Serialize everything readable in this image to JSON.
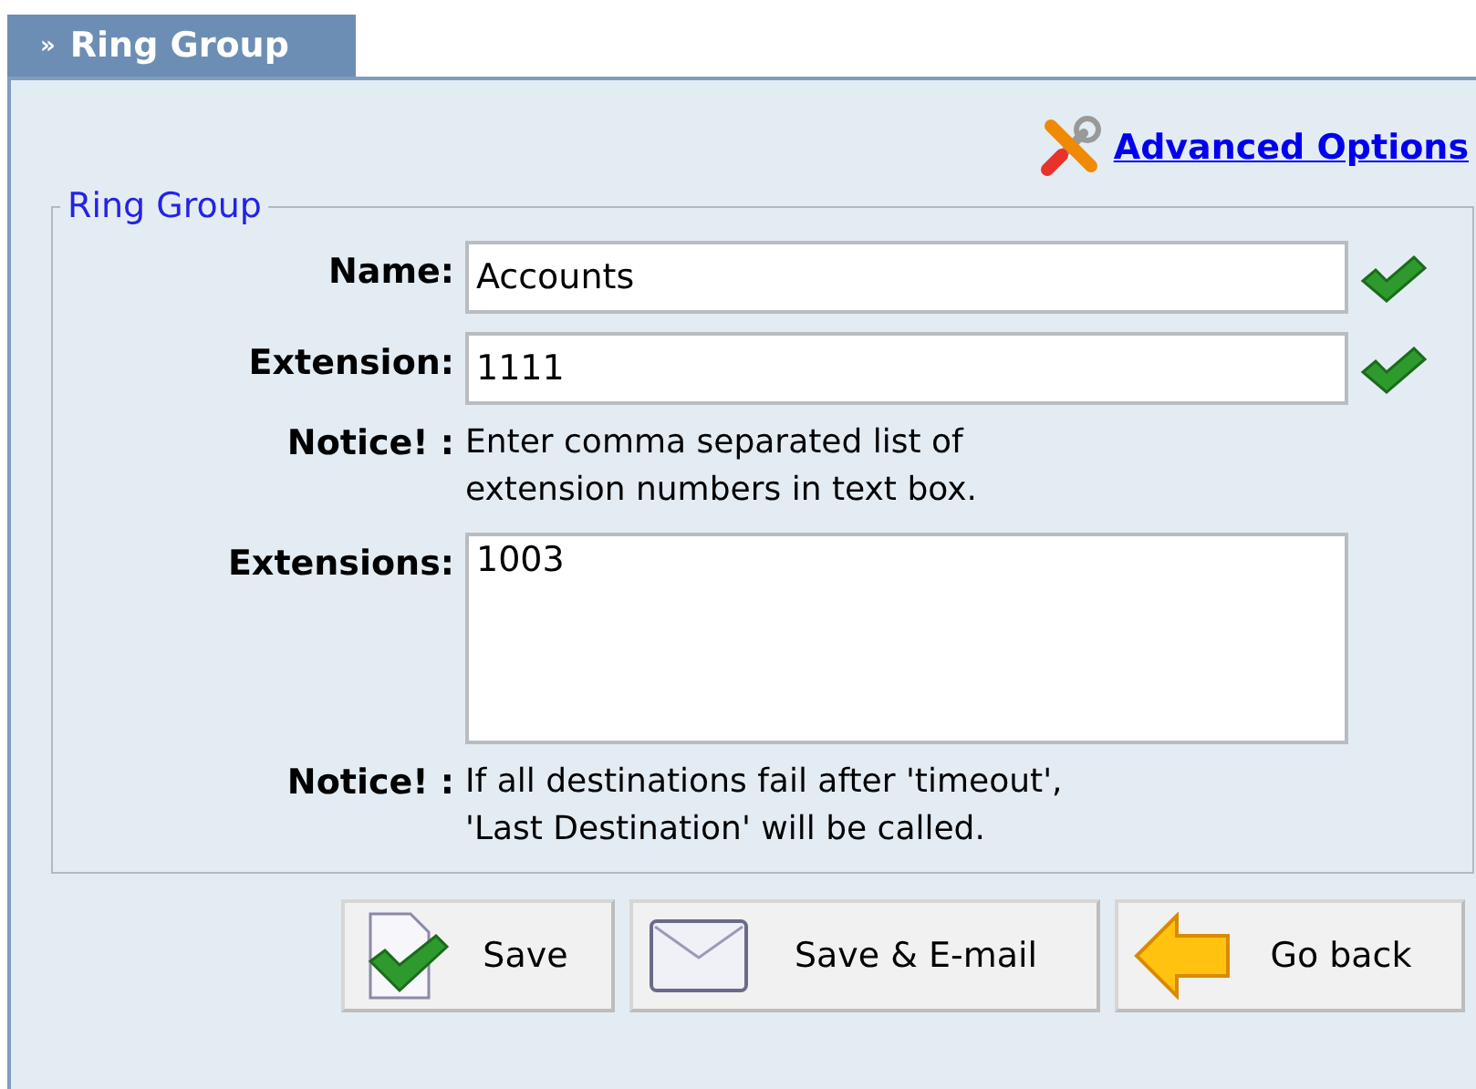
{
  "tab": {
    "arrow": "»",
    "label": "Ring Group"
  },
  "advanced_link": "Advanced Options",
  "fieldset": {
    "legend": "Ring Group",
    "rows": [
      {
        "kind": "field",
        "label": "Name:",
        "value": "Accounts",
        "valid": true
      },
      {
        "kind": "field",
        "label": "Extension:",
        "value": "1111",
        "valid": true
      },
      {
        "kind": "notice",
        "label": "Notice! :",
        "text": "Enter comma separated list of\nextension numbers in text box."
      },
      {
        "kind": "textarea",
        "label": "Extensions:",
        "value": "1003"
      },
      {
        "kind": "notice",
        "label": "Notice! :",
        "text": "If all destinations fail after 'timeout',\n'Last Destination' will be called."
      }
    ]
  },
  "buttons": [
    {
      "kind": "save",
      "label": "Save"
    },
    {
      "kind": "email",
      "label": "Save & E-mail"
    },
    {
      "kind": "back",
      "label": "Go back"
    }
  ]
}
